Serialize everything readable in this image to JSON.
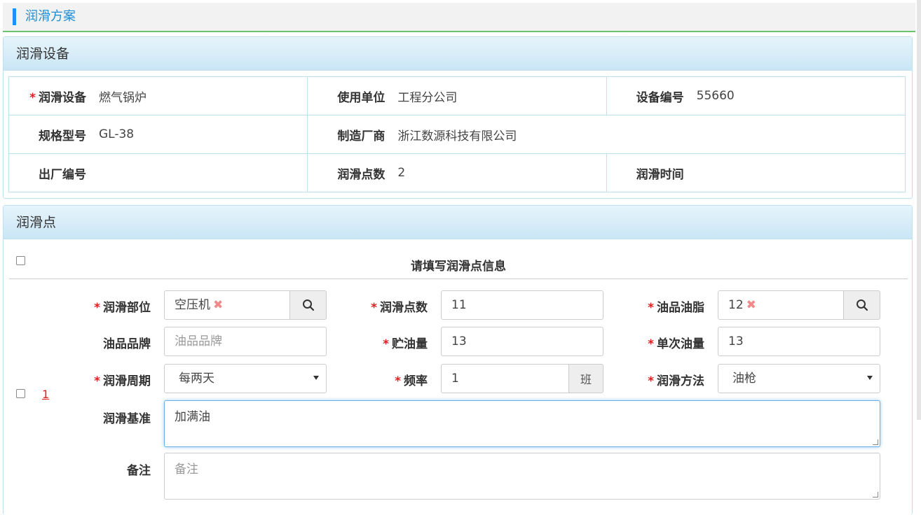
{
  "page": {
    "title": "润滑方案"
  },
  "device_panel": {
    "title": "润滑设备",
    "fields": [
      {
        "label": "润滑设备",
        "value": "燃气锅炉",
        "required": true
      },
      {
        "label": "使用单位",
        "value": "工程分公司",
        "required": false
      },
      {
        "label": "设备编号",
        "value": "55660",
        "required": false
      },
      {
        "label": "规格型号",
        "value": "GL-38",
        "required": false
      },
      {
        "label": "制造厂商",
        "value": "浙江数源科技有限公司",
        "required": false
      },
      {
        "label": "出厂编号",
        "value": "",
        "required": false
      },
      {
        "label": "润滑点数",
        "value": "2",
        "required": false
      },
      {
        "label": "润滑时间",
        "value": "",
        "required": false
      }
    ]
  },
  "points_panel": {
    "title": "润滑点",
    "header": "请填写润滑点信息",
    "row_number": "1",
    "form": {
      "part": {
        "label": "润滑部位",
        "value": "空压机",
        "remove": "✖"
      },
      "point_count": {
        "label": "润滑点数",
        "value": "11"
      },
      "oil_grease": {
        "label": "油品油脂",
        "value": "12",
        "remove": "✖"
      },
      "oil_brand": {
        "label": "油品品牌",
        "placeholder": "油品品牌"
      },
      "storage": {
        "label": "贮油量",
        "value": "13"
      },
      "single_amount": {
        "label": "单次油量",
        "value": "13"
      },
      "cycle": {
        "label": "润滑周期",
        "value": "每两天"
      },
      "frequency": {
        "label": "频率",
        "value": "1",
        "unit": "班"
      },
      "method": {
        "label": "润滑方法",
        "value": "油枪"
      },
      "standard": {
        "label": "润滑基准",
        "value": "加满油"
      },
      "remark": {
        "label": "备注",
        "placeholder": "备注"
      }
    },
    "required_mark": "*"
  }
}
